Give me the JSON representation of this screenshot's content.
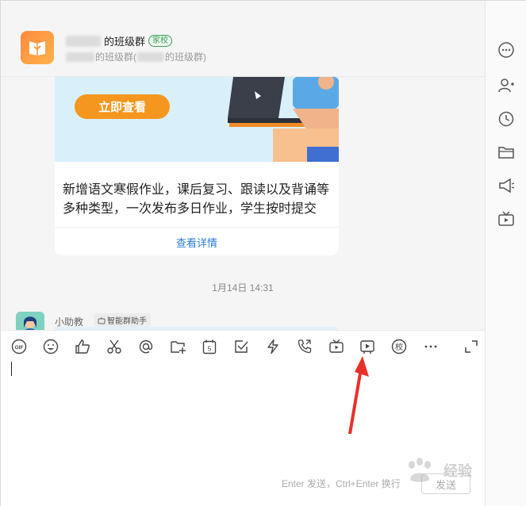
{
  "header": {
    "group_name_suffix": "的班级群",
    "tag": "家校",
    "sub_mid": "的班级群(",
    "sub_end": "的班级群)"
  },
  "chat": {
    "card": {
      "cta": "立即查看",
      "description": "新增语文寒假作业，课后复习、跟读以及背诵等多种类型，一次发布多日作业，学生按时提交",
      "link": "查看详情"
    },
    "timestamp": "1月14日 14:31",
    "last_message": {
      "sender": "小助教",
      "tag": "智能群助手"
    }
  },
  "toolbar": {
    "items": [
      {
        "name": "gif",
        "label": "GIF"
      },
      {
        "name": "emoji"
      },
      {
        "name": "thumbs-up"
      },
      {
        "name": "scissors"
      },
      {
        "name": "at-mention"
      },
      {
        "name": "folder-add"
      },
      {
        "name": "calendar",
        "label": "5"
      },
      {
        "name": "checkbox"
      },
      {
        "name": "lightning"
      },
      {
        "name": "phone-call"
      },
      {
        "name": "tv"
      },
      {
        "name": "play-video"
      },
      {
        "name": "school",
        "label": "校"
      },
      {
        "name": "more"
      },
      {
        "name": "expand"
      }
    ]
  },
  "input": {
    "hint": "Enter 发送，Ctrl+Enter 换行",
    "send_label": "发送"
  },
  "sidebar": {
    "items": [
      "more",
      "add-member",
      "history",
      "files",
      "announcement",
      "live"
    ]
  },
  "watermark": {
    "text": "经验"
  },
  "colors": {
    "accent_orange": "#f5961e",
    "link_blue": "#2b7bdb",
    "tag_green": "#2da44e",
    "arrow_red": "#e8302a"
  }
}
